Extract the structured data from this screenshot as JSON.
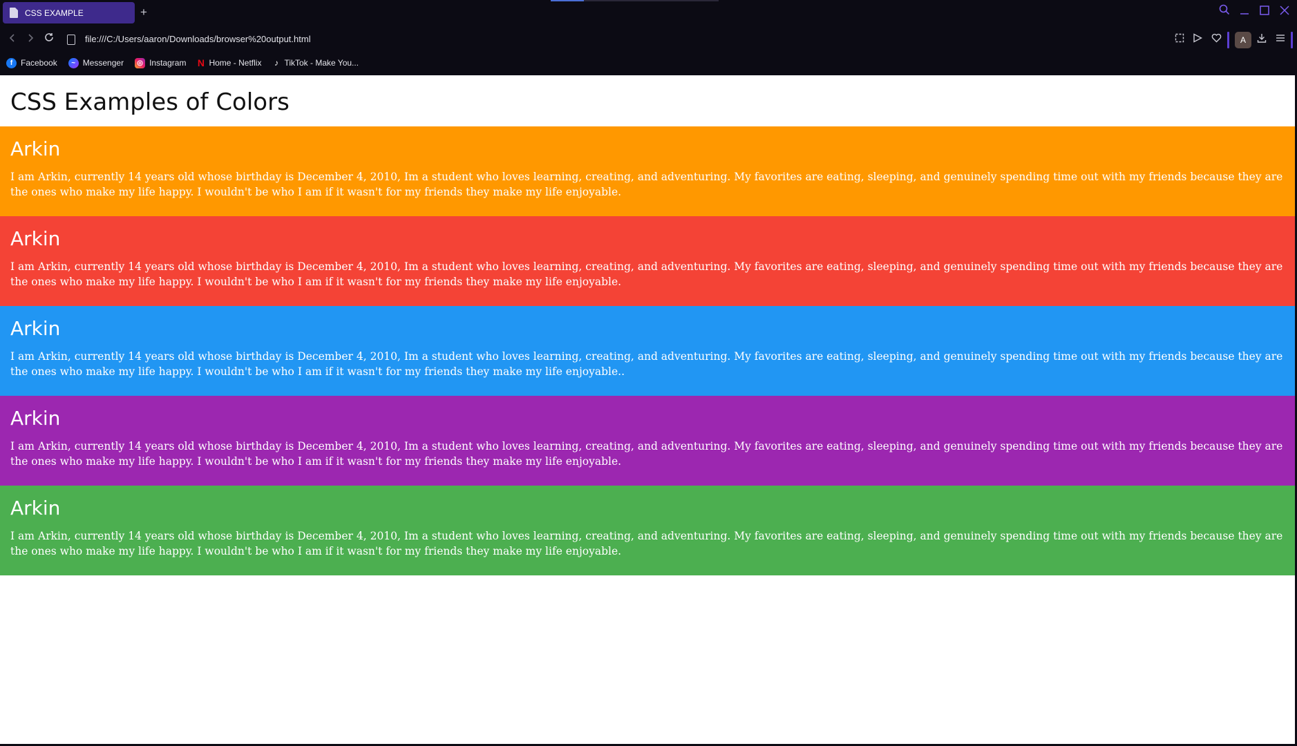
{
  "browser": {
    "tab_title": "CSS EXAMPLE",
    "new_tab_label": "+",
    "url": "file:///C:/Users/aaron/Downloads/browser%20output.html",
    "profile_initial": "A",
    "accent_color": "#5b3fd1",
    "icons": {
      "back": "chevron-left-icon",
      "forward": "chevron-right-icon",
      "reload": "reload-icon",
      "page": "document-icon",
      "search": "search-icon",
      "minimize": "minimize-icon",
      "maximize": "maximize-icon",
      "close": "close-icon",
      "screenshot": "screenshot-icon",
      "play": "play-icon",
      "favorite": "heart-icon",
      "download": "download-icon",
      "menu": "menu-icon"
    }
  },
  "bookmarks": [
    {
      "label": "Facebook",
      "icon": "facebook-icon"
    },
    {
      "label": "Messenger",
      "icon": "messenger-icon"
    },
    {
      "label": "Instagram",
      "icon": "instagram-icon"
    },
    {
      "label": "Home - Netflix",
      "icon": "netflix-icon"
    },
    {
      "label": "TikTok - Make You...",
      "icon": "tiktok-icon"
    }
  ],
  "page": {
    "title": "CSS Examples of Colors",
    "sections": [
      {
        "heading": "Arkin",
        "text": "I am Arkin, currently 14 years old whose birthday is December 4, 2010, Im a student who loves learning, creating, and adventuring. My favorites are eating, sleeping, and genuinely spending time out with my friends because they are the ones who make my life happy. I wouldn't be who I am if it wasn't for my friends they make my life enjoyable.",
        "color": "#ff9800"
      },
      {
        "heading": "Arkin",
        "text": "I am Arkin, currently 14 years old whose birthday is December 4, 2010, Im a student who loves learning, creating, and adventuring. My favorites are eating, sleeping, and genuinely spending time out with my friends because they are the ones who make my life happy. I wouldn't be who I am if it wasn't for my friends they make my life enjoyable.",
        "color": "#f44336"
      },
      {
        "heading": "Arkin",
        "text": "I am Arkin, currently 14 years old whose birthday is December 4, 2010, Im a student who loves learning, creating, and adventuring. My favorites are eating, sleeping, and genuinely spending time out with my friends because they are the ones who make my life happy. I wouldn't be who I am if it wasn't for my friends they make my life enjoyable..",
        "color": "#2196f3"
      },
      {
        "heading": "Arkin",
        "text": "I am Arkin, currently 14 years old whose birthday is December 4, 2010, Im a student who loves learning, creating, and adventuring. My favorites are eating, sleeping, and genuinely spending time out with my friends because they are the ones who make my life happy. I wouldn't be who I am if it wasn't for my friends they make my life enjoyable.",
        "color": "#9c27b0"
      },
      {
        "heading": "Arkin",
        "text": "I am Arkin, currently 14 years old whose birthday is December 4, 2010, Im a student who loves learning, creating, and adventuring. My favorites are eating, sleeping, and genuinely spending time out with my friends because they are the ones who make my life happy. I wouldn't be who I am if it wasn't for my friends they make my life enjoyable.",
        "color": "#4caf50"
      }
    ]
  }
}
